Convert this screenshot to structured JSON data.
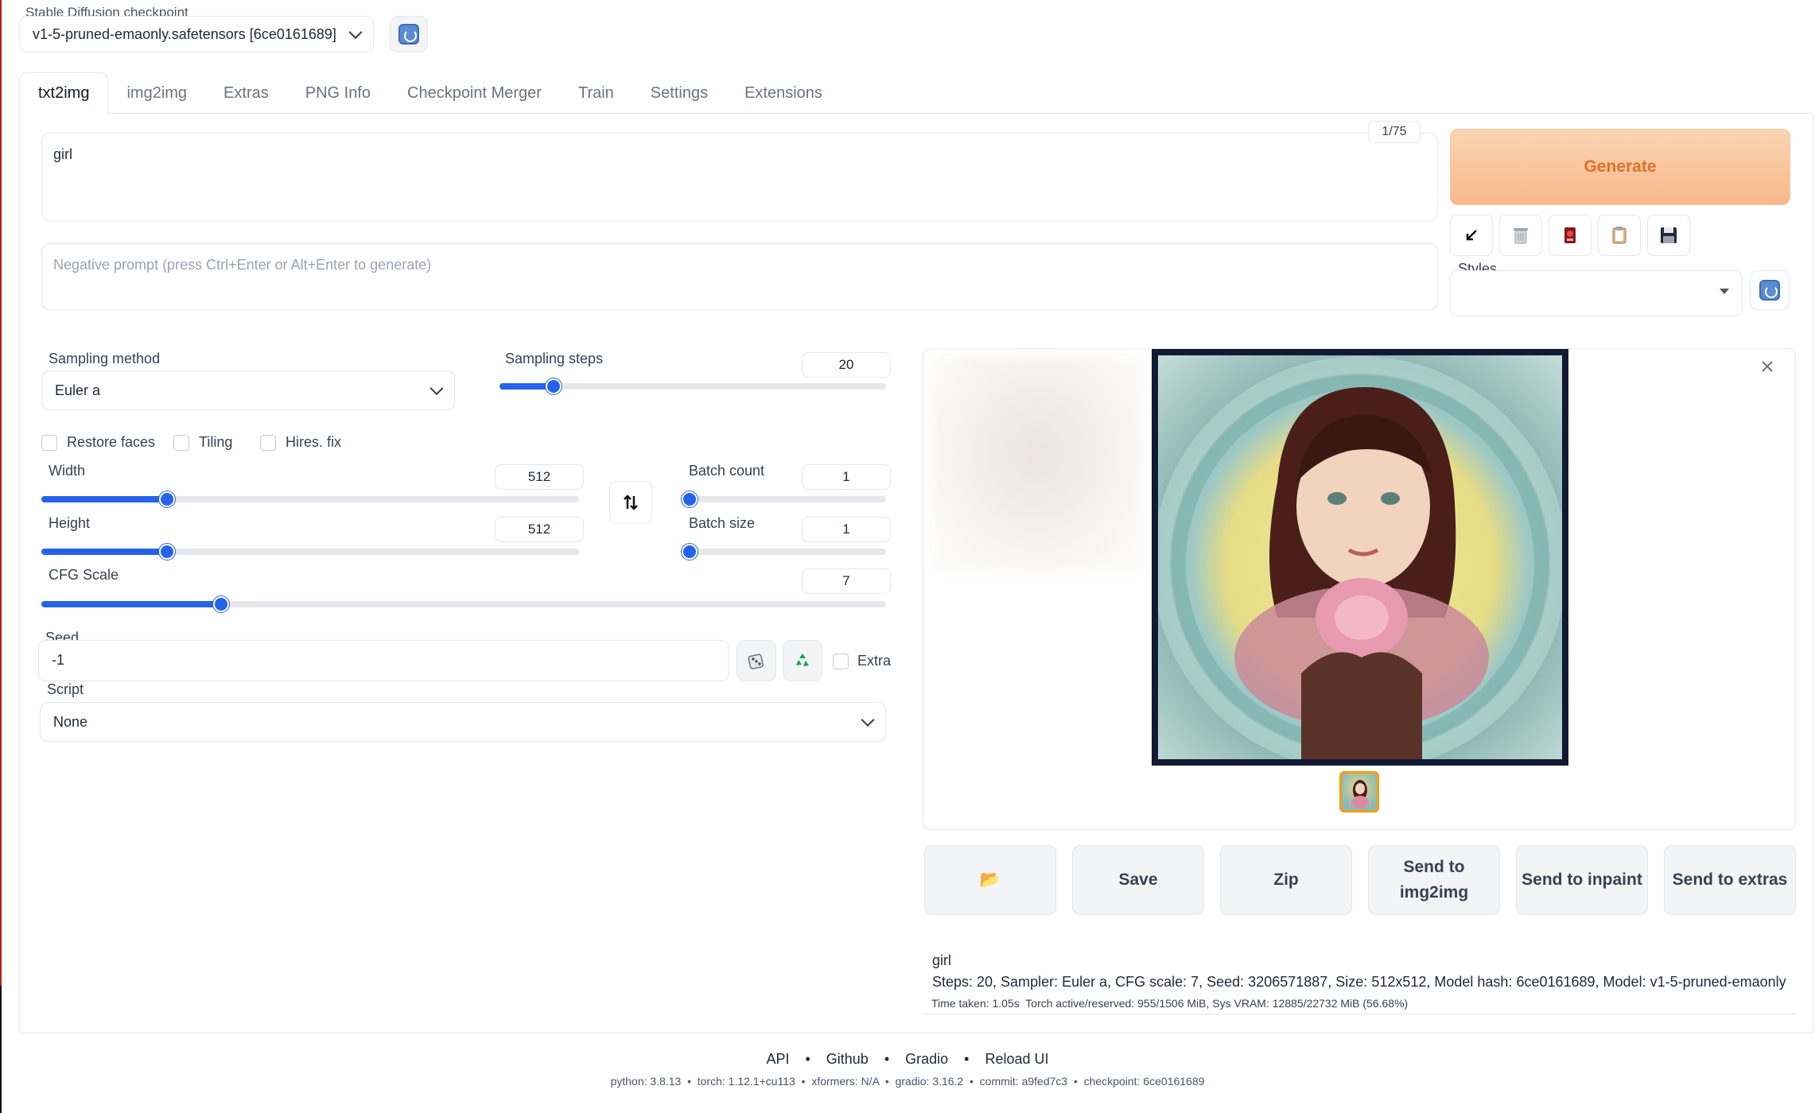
{
  "checkpoint": {
    "label": "Stable Diffusion checkpoint",
    "value": "v1-5-pruned-emaonly.safetensors [6ce0161689]"
  },
  "tabs": [
    "txt2img",
    "img2img",
    "Extras",
    "PNG Info",
    "Checkpoint Merger",
    "Train",
    "Settings",
    "Extensions"
  ],
  "prompt": {
    "value": "girl",
    "token_count": "1/75",
    "negative_placeholder": "Negative prompt (press Ctrl+Enter or Alt+Enter to generate)"
  },
  "toolbar": {
    "generate_label": "Generate",
    "styles_label": "Styles"
  },
  "sampling": {
    "method_label": "Sampling method",
    "method_value": "Euler a",
    "steps_label": "Sampling steps",
    "steps_value": "20",
    "steps_min": 1,
    "steps_max": 150
  },
  "options": {
    "restore_faces": "Restore faces",
    "tiling": "Tiling",
    "hires_fix": "Hires. fix"
  },
  "size": {
    "width_label": "Width",
    "width_value": "512",
    "height_label": "Height",
    "height_value": "512"
  },
  "batch": {
    "count_label": "Batch count",
    "count_value": "1",
    "size_label": "Batch size",
    "size_value": "1"
  },
  "cfg": {
    "label": "CFG Scale",
    "value": "7"
  },
  "seed": {
    "label": "Seed",
    "value": "-1",
    "extra_label": "Extra"
  },
  "script": {
    "label": "Script",
    "value": "None"
  },
  "actions": {
    "folder": "📂",
    "save": "Save",
    "zip": "Zip",
    "send_img2img": "Send to img2img",
    "send_inpaint": "Send to inpaint",
    "send_extras": "Send to extras"
  },
  "output_info": {
    "prompt": "girl",
    "params": "Steps: 20, Sampler: Euler a, CFG scale: 7, Seed: 3206571887, Size: 512x512, Model hash: 6ce0161689, Model: v1-5-pruned-emaonly",
    "time": "Time taken: 1.05s  Torch active/reserved: 955/1506 MiB, Sys VRAM: 12885/22732 MiB (56.68%)"
  },
  "footer": {
    "links": [
      "API",
      "Github",
      "Gradio",
      "Reload UI"
    ],
    "meta": "python: 3.8.13  •  torch: 1.12.1+cu113  •  xformers: N/A  •  gradio: 3.16.2  •  commit: a9fed7c3  •  checkpoint: 6ce0161689"
  },
  "colors": {
    "accent": "#2563eb",
    "generate": "#e0702a",
    "generate_bg": "#f8b88a"
  }
}
